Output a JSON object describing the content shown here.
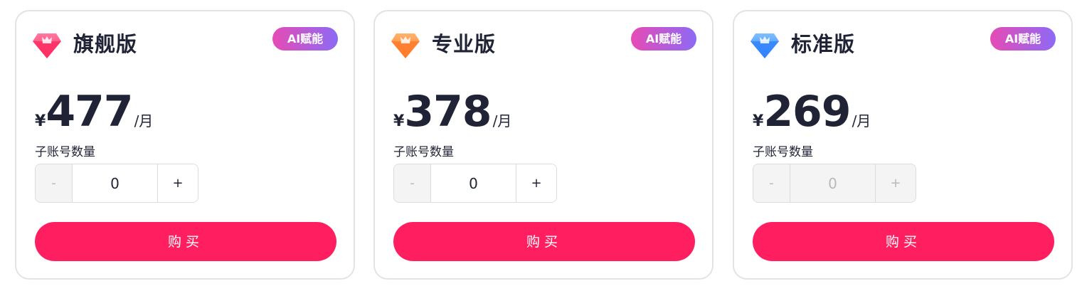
{
  "colors": {
    "buy_button": "#ff1f60",
    "badge_gradient_start": "#e64bb5",
    "badge_gradient_end": "#8d6af5",
    "text_dark": "#1f2335"
  },
  "plans": [
    {
      "name": "旗舰版",
      "gem_icon": "diamond-icon-pink",
      "gem_color": "#ff3d73",
      "badge": "AI赋能",
      "currency": "¥",
      "price": "477",
      "unit": "/月",
      "qty_label": "子账号数量",
      "minus": "-",
      "qty_value": "0",
      "plus": "+",
      "buy_label": "购买",
      "stepper_enabled": true
    },
    {
      "name": "专业版",
      "gem_icon": "diamond-icon-orange",
      "gem_color": "#ff8a3a",
      "badge": "AI赋能",
      "currency": "¥",
      "price": "378",
      "unit": "/月",
      "qty_label": "子账号数量",
      "minus": "-",
      "qty_value": "0",
      "plus": "+",
      "buy_label": "购买",
      "stepper_enabled": true
    },
    {
      "name": "标准版",
      "gem_icon": "diamond-icon-blue",
      "gem_color": "#3f8cff",
      "badge": "AI赋能",
      "currency": "¥",
      "price": "269",
      "unit": "/月",
      "qty_label": "子账号数量",
      "minus": "-",
      "qty_value": "0",
      "plus": "+",
      "buy_label": "购买",
      "stepper_enabled": false
    }
  ]
}
